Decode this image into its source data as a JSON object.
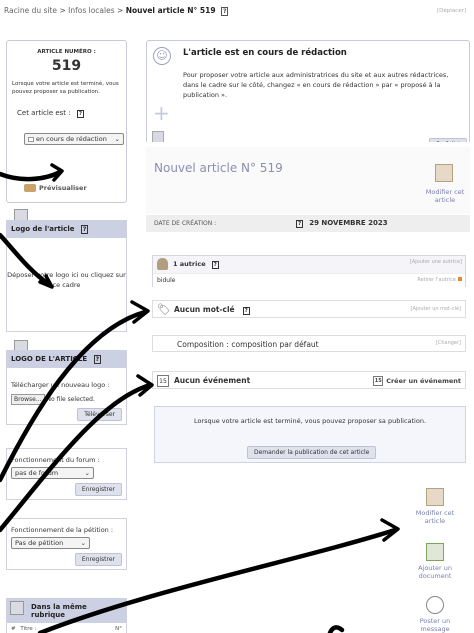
{
  "breadcrumb": {
    "home": "Racine du site",
    "sep1": ">",
    "section": "Infos locales",
    "sep2": ">",
    "current": "Nouvel article N° 519",
    "help": "?",
    "move": "[Déplacer]"
  },
  "left": {
    "article_label": "ARTICLE NUMÉRO :",
    "article_number": "519",
    "article_hint": "Lorsque votre article est terminé, vous pouvez proposer sa publication.",
    "status_label": "Cet article est :",
    "status_help": "?",
    "status_value": "en cours de rédaction",
    "preview": "Prévisualiser",
    "logo_title": "Logo de l'article",
    "logo_help": "?",
    "logo_drop_text": "Déposer votre logo ici ou cliquez sur ce cadre",
    "logo2_title": "LOGO DE L'ARTICLE",
    "logo2_help": "?",
    "upload_label": "Télécharger un nouveau logo :",
    "browse_btn": "Browse...",
    "no_file": "No file selected.",
    "upload_btn": "Téléverser",
    "forum_label": "Fonctionnement du forum :",
    "forum_value": "pas de forum",
    "forum_save": "Enregistrer",
    "petition_label": "Fonctionnement de la pétition :",
    "petition_value": "Pas de pétition",
    "petition_save": "Enregistrer",
    "same_rubric_title": "Dans la même rubrique",
    "col_hash": "#",
    "col_title": "Titre :",
    "col_num": "N°"
  },
  "notice": {
    "title": "L'article est en cours de rédaction",
    "text": "Pour proposer votre article aux administratrices du site et aux autres rédactrices, dans le cadre sur le côté, changez « en cours de rédaction » par « proposé à la publication ».",
    "button": "Parfait !"
  },
  "article": {
    "title": "Nouvel article N° 519",
    "edit_label": "Modifier cet article",
    "date_label": "DATE DE CRÉATION :",
    "date_help": "?",
    "date_value": "29 NOVEMBRE 2023",
    "authors_title": "1 autrice",
    "authors_help": "?",
    "add_author": "[Ajouter une autrice]",
    "author_name": "bidule",
    "remove_author": "Retirer l'autrice",
    "keyword_title": "Aucun mot-clé",
    "keyword_help": "?",
    "add_keyword": "[Ajouter un mot-clé]",
    "composition_label": "Composition :",
    "composition_value": "composition par défaut",
    "change": "[Changer]",
    "event_title": "Aucun événement",
    "create_event": "Créer un événement",
    "calendar_num": "15",
    "publish_hint": "Lorsque votre article est terminé, vous pouvez proposer sa publication.",
    "publish_btn": "Demander la publication de cet article"
  },
  "side_actions": {
    "edit": "Modifier cet article",
    "add_doc": "Ajouter un document",
    "post_msg": "Poster un message"
  }
}
